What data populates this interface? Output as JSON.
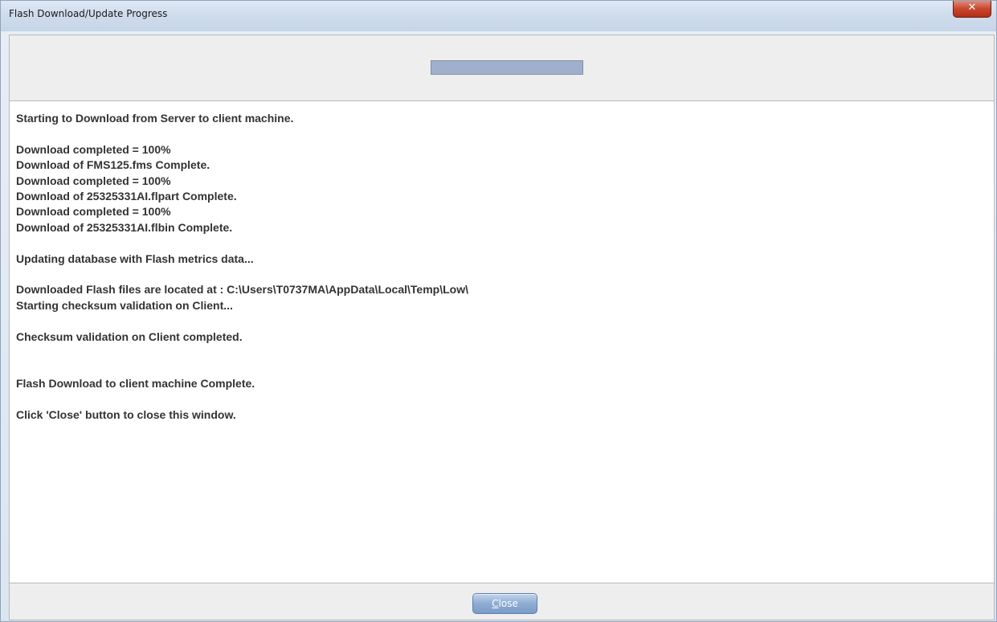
{
  "window": {
    "title": "Flash Download/Update Progress",
    "close_glyph": "✕"
  },
  "progress": {
    "value": 1.0
  },
  "log": {
    "lines": [
      "Starting to Download from Server to client machine.",
      "",
      "Download completed = 100%",
      "Download of FMS125.fms Complete.",
      "Download completed = 100%",
      "Download of 25325331AI.flpart Complete.",
      "Download completed = 100%",
      "Download of 25325331AI.flbin Complete.",
      "",
      "Updating database with Flash metrics data...",
      "",
      "Downloaded Flash files are located at : C:\\Users\\T0737MA\\AppData\\Local\\Temp\\Low\\",
      "Starting checksum validation on Client...",
      "",
      "Checksum validation on Client completed.",
      "",
      "",
      "Flash Download to client machine Complete.",
      "",
      "Click 'Close' button to close this window."
    ]
  },
  "footer": {
    "close_mnemonic": "C",
    "close_rest": "lose"
  },
  "colors": {
    "progress_fill": "#9fb0cc",
    "close_button": "#8facd3",
    "titlebar_close": "#c9452d"
  }
}
